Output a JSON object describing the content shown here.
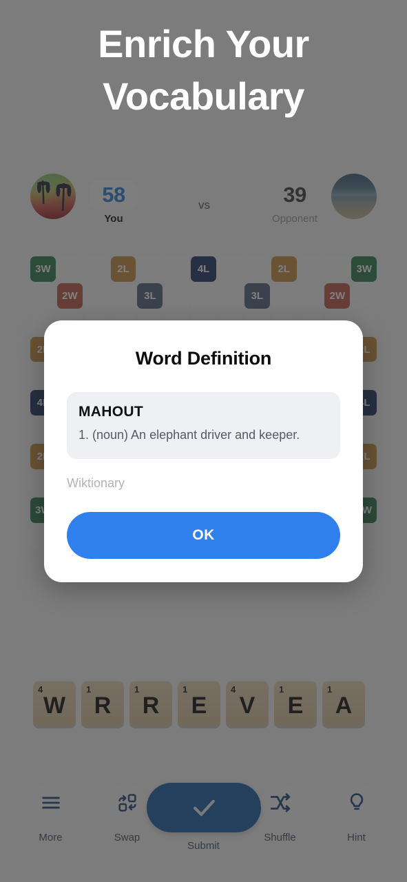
{
  "promo": {
    "headline_line1": "Enrich Your",
    "headline_line2": "Vocabulary"
  },
  "scoreboard": {
    "you_avatar_alt": "palm-tree-sunset-avatar",
    "you_score": "58",
    "you_label": "You",
    "vs_label": "vs",
    "opponent_score": "39",
    "opponent_label": "Opponent",
    "opponent_avatar_alt": "beach-ocean-avatar"
  },
  "board": {
    "columns": 13,
    "rows": [
      [
        "3W",
        "",
        "",
        "2L",
        "",
        "",
        "4L",
        "",
        "",
        "2L",
        "",
        "",
        "3W"
      ],
      [
        "",
        "2W",
        "",
        "",
        "3L",
        "",
        "",
        "",
        "3L",
        "",
        "",
        "2W",
        ""
      ],
      [
        "",
        "",
        "",
        "",
        "",
        "",
        "",
        "",
        "",
        "",
        "",
        "",
        ""
      ],
      [
        "2L",
        "",
        "",
        "",
        "",
        "",
        "",
        "",
        "",
        "",
        "",
        "",
        "2L"
      ],
      [
        "",
        "",
        "",
        "",
        "",
        "",
        "",
        "",
        "",
        "",
        "",
        "",
        ""
      ],
      [
        "4L",
        "",
        "",
        "",
        "",
        "",
        "",
        "",
        "",
        "",
        "",
        "",
        "4L"
      ],
      [
        "",
        "",
        "",
        "",
        "",
        "",
        "",
        "",
        "",
        "",
        "",
        "",
        ""
      ],
      [
        "2L",
        "",
        "",
        "",
        "",
        "",
        "",
        "",
        "",
        "",
        "",
        "",
        "2L"
      ],
      [
        "",
        "",
        "",
        "",
        "",
        "",
        "",
        "",
        "",
        "",
        "",
        "",
        ""
      ],
      [
        "3W",
        "",
        "",
        "",
        "",
        "",
        "",
        "",
        "",
        "",
        "",
        "",
        "3W"
      ],
      [
        "",
        "",
        "",
        "",
        "",
        "",
        "",
        "",
        "",
        "",
        "",
        "",
        ""
      ]
    ]
  },
  "rack": {
    "tiles": [
      {
        "letter": "W",
        "points": "4"
      },
      {
        "letter": "R",
        "points": "1"
      },
      {
        "letter": "R",
        "points": "1"
      },
      {
        "letter": "E",
        "points": "1"
      },
      {
        "letter": "V",
        "points": "4"
      },
      {
        "letter": "E",
        "points": "1"
      },
      {
        "letter": "A",
        "points": "1"
      }
    ]
  },
  "toolbar": {
    "more_label": "More",
    "swap_label": "Swap",
    "submit_label": "Submit",
    "shuffle_label": "Shuffle",
    "hint_label": "Hint"
  },
  "dialog": {
    "title": "Word Definition",
    "word": "MAHOUT",
    "definition": "1. (noun) An elephant driver and keeper.",
    "source": "Wiktionary",
    "ok_label": "OK"
  },
  "colors": {
    "accent_blue": "#2f80ed",
    "submit_navy": "#1d5fa8",
    "triple_word": "#2f7a4e",
    "double_word": "#c1584a",
    "quad_letter": "#223566",
    "triple_letter": "#53617f",
    "double_letter": "#c98e44",
    "tile_wood": "#d9c3a0",
    "overlay": "rgba(44,44,44,0.60)"
  }
}
